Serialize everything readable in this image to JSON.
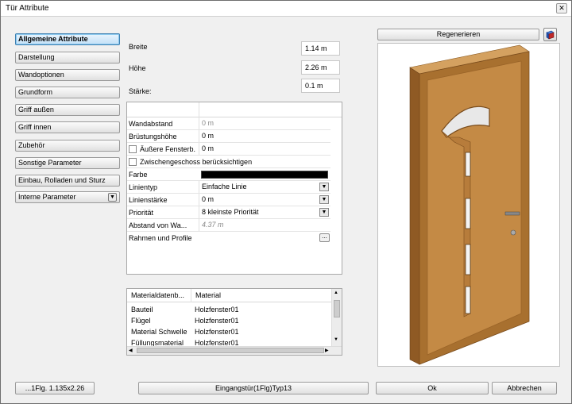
{
  "window": {
    "title": "Tür Attribute",
    "close_glyph": "✕"
  },
  "sidebar": {
    "items": [
      {
        "label": "Allgemeine Attribute",
        "active": true
      },
      {
        "label": "Darstellung"
      },
      {
        "label": "Wandoptionen"
      },
      {
        "label": "Grundform"
      },
      {
        "label": "Griff außen"
      },
      {
        "label": "Griff innen"
      },
      {
        "label": "Zubehör"
      },
      {
        "label": "Sonstige Parameter"
      },
      {
        "label": "Einbau, Rolladen und Sturz"
      },
      {
        "label": "Interne Parameter"
      }
    ]
  },
  "dimensions": {
    "breite_label": "Breite",
    "breite_value": "1.14 m",
    "hoehe_label": "Höhe",
    "hoehe_value": "2.26 m",
    "staerke_label": "Stärke:",
    "staerke_value": "0.1 m"
  },
  "properties": {
    "rows": [
      {
        "name": "Wandabstand",
        "value": "0 m"
      },
      {
        "name": "Brüstungshöhe",
        "value": "0 m"
      },
      {
        "name": "Äußere Fensterb.",
        "value": "0 m"
      },
      {
        "name": "Zwischengeschoss berücksichtigen"
      },
      {
        "name": "Farbe",
        "color": "#000000"
      },
      {
        "name": "Linientyp",
        "value": "Einfache Linie"
      },
      {
        "name": "Linienstärke",
        "value": "0 m"
      },
      {
        "name": "Priorität",
        "value": "8 kleinste Priorität"
      },
      {
        "name": "Abstand von Wa...",
        "value": "4.37 m"
      },
      {
        "name": "Rahmen und Profile",
        "ellipsis": "..."
      }
    ]
  },
  "materials": {
    "headers": [
      "Materialdatenb...",
      "Material"
    ],
    "rows": [
      [
        "Bauteil",
        "Holzfenster01"
      ],
      [
        "Flügel",
        "Holzfenster01"
      ],
      [
        "Material Schwelle",
        "Holzfenster01"
      ],
      [
        "Füllungsmaterial",
        "Holzfenster01"
      ]
    ]
  },
  "preview": {
    "regenerate_label": "Regenerieren",
    "door_color": "#c48a45",
    "frame_color": "#a8702f"
  },
  "footer": {
    "info_label": "...1Flg. 1.135x2.26",
    "type_label": "Eingangstür(1Flg)Typ13",
    "ok_label": "Ok",
    "cancel_label": "Abbrechen"
  }
}
